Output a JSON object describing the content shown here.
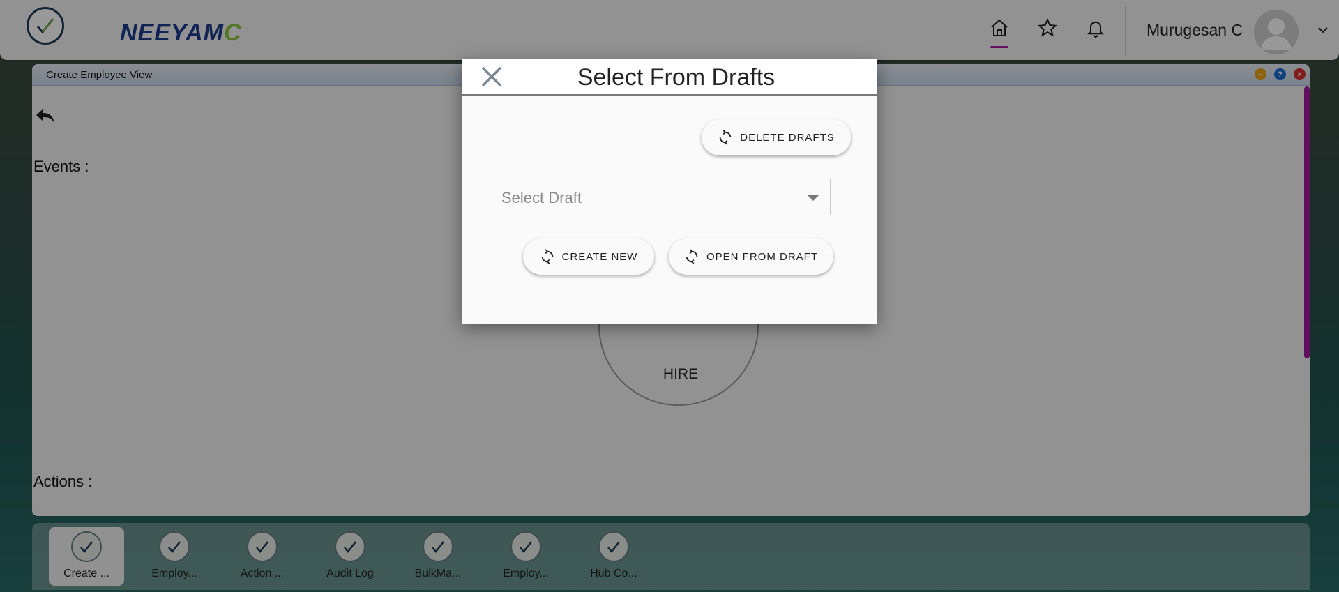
{
  "header": {
    "brand_main": "NEEYAM",
    "brand_tail": "C",
    "user_name": "Murugesan C",
    "icons": [
      "home-icon",
      "star-icon",
      "bell-icon",
      "avatar",
      "chevron-down-icon"
    ],
    "accent_color": "#a31a9b"
  },
  "window": {
    "title": "Create Employee View",
    "events_label": "Events :",
    "actions_label": "Actions :",
    "hire_label": "HIRE"
  },
  "dialog": {
    "title": "Select From Drafts",
    "delete_drafts_label": "DELETE DRAFTS",
    "select_placeholder": "Select Draft",
    "create_new_label": "CREATE NEW",
    "open_from_draft_label": "OPEN FROM DRAFT"
  },
  "taskbar": {
    "items": [
      {
        "label": "Create ...",
        "active": true
      },
      {
        "label": "Employ...",
        "active": false
      },
      {
        "label": "Action ...",
        "active": false
      },
      {
        "label": "Audit Log",
        "active": false
      },
      {
        "label": "BulkMa...",
        "active": false
      },
      {
        "label": "Employ...",
        "active": false
      },
      {
        "label": "Hub Co...",
        "active": false
      }
    ]
  }
}
